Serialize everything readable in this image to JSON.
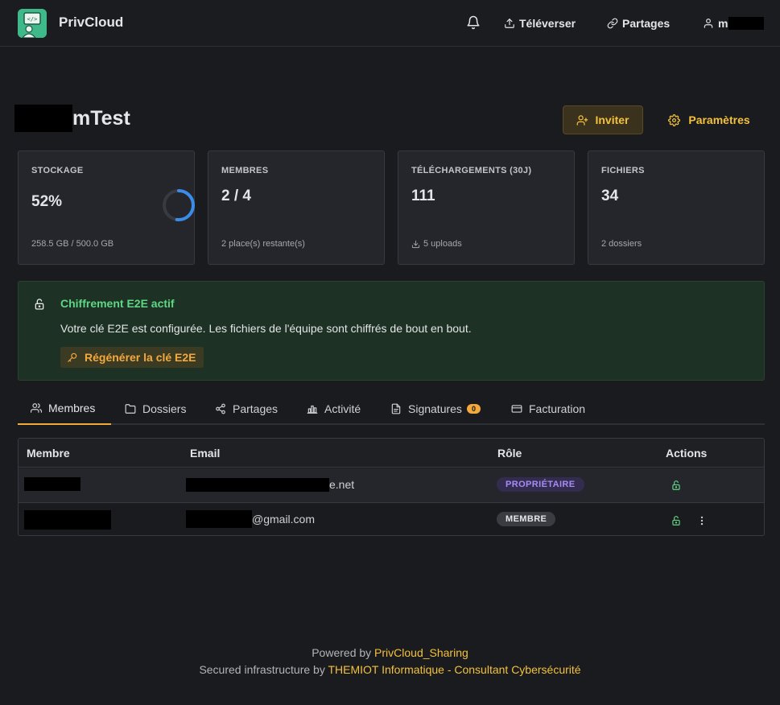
{
  "header": {
    "brand": "PrivCloud",
    "nav": {
      "upload": "Téléverser",
      "shares": "Partages",
      "user_visible": "m"
    }
  },
  "team": {
    "title_visible": "mTest",
    "invite_label": "Inviter",
    "settings_label": "Paramètres"
  },
  "stats": {
    "storage": {
      "label": "STOCKAGE",
      "value": "52%",
      "sub": "258.5 GB / 500.0 GB",
      "percent": 0.52
    },
    "members": {
      "label": "MEMBRES",
      "value": "2 / 4",
      "sub": "2 place(s) restante(s)"
    },
    "downloads": {
      "label": "TÉLÉCHARGEMENTS (30J)",
      "value": "111",
      "sub": "5 uploads"
    },
    "files": {
      "label": "FICHIERS",
      "value": "34",
      "sub": "2 dossiers"
    }
  },
  "e2e": {
    "title": "Chiffrement E2E actif",
    "description": "Votre clé E2E est configurée. Les fichiers de l'équipe sont chiffrés de bout en bout.",
    "regen_label": "Régénérer la clé E2E"
  },
  "tabs": [
    {
      "label": "Membres",
      "icon": "users-icon"
    },
    {
      "label": "Dossiers",
      "icon": "folder-icon"
    },
    {
      "label": "Partages",
      "icon": "share-icon"
    },
    {
      "label": "Activité",
      "icon": "chart-icon"
    },
    {
      "label": "Signatures",
      "icon": "document-icon",
      "badge": "0"
    },
    {
      "label": "Facturation",
      "icon": "card-icon"
    }
  ],
  "table": {
    "headers": [
      "Membre",
      "Email",
      "Rôle",
      "Actions"
    ],
    "rows": [
      {
        "email_visible": "e.net",
        "role": "PROPRIÉTAIRE"
      },
      {
        "email_visible": "@gmail.com",
        "role": "MEMBRE"
      }
    ]
  },
  "footer": {
    "powered_prefix": "Powered by ",
    "powered_link": "PrivCloud_Sharing",
    "secured_prefix": "Secured infrastructure by ",
    "secured_link": "THEMIOT Informatique - Consultant Cybersécurité"
  },
  "colors": {
    "accent": "#f4c13c",
    "e2e_green": "#5fd784",
    "owner_badge": "#a58cf5"
  }
}
